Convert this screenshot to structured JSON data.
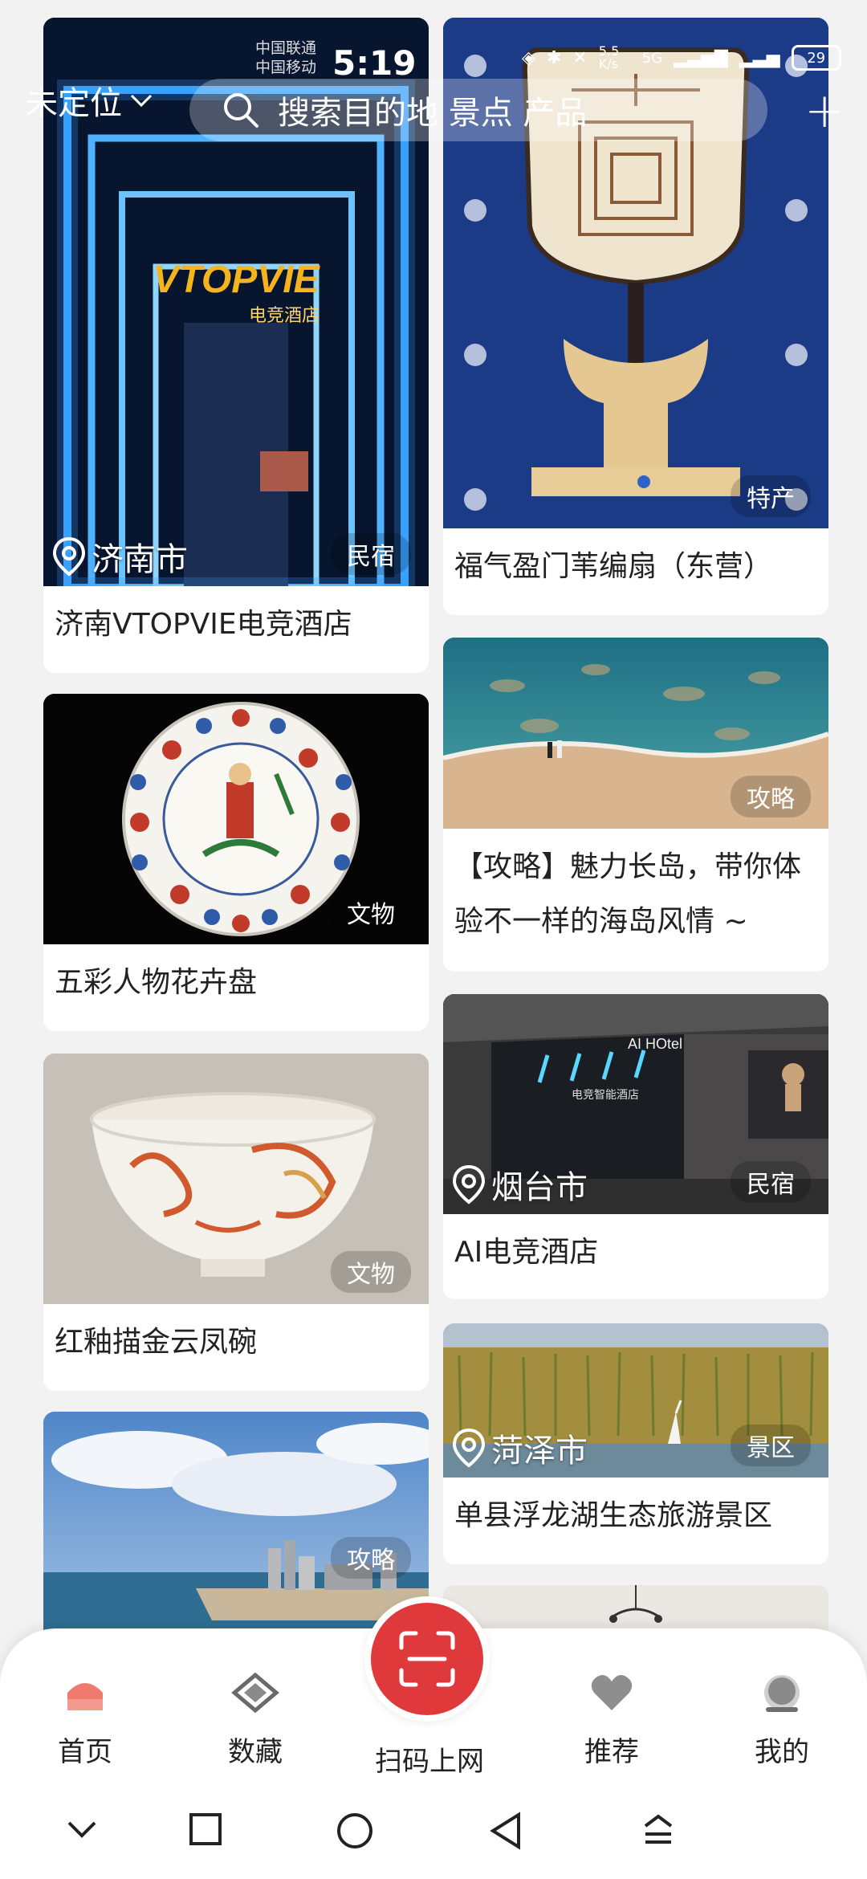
{
  "status_bar": {
    "carrier_1": "中国联通",
    "carrier_2": "中国移动",
    "time": "5:19",
    "net_speed": "5.5 K/s",
    "network": "5G",
    "battery": "29"
  },
  "header": {
    "location": "未定位",
    "search_placeholder": "搜索目的地 景点 产品"
  },
  "feed": {
    "left": [
      {
        "title": "济南VTOPVIE电竞酒店",
        "tag": "民宿",
        "city": "济南市",
        "sign_text": "VTOPVIE",
        "sign_sub": "电竞酒店"
      },
      {
        "title": "五彩人物花卉盘",
        "tag": "文物"
      },
      {
        "title": "红釉描金云凤碗",
        "tag": "文物"
      },
      {
        "title": "",
        "tag": "攻略"
      }
    ],
    "right": [
      {
        "title": "福气盈门苇编扇（东营）",
        "tag": "特产"
      },
      {
        "title": "【攻略】魅力长岛，带你体验不一样的海岛风情 ~",
        "tag": "攻略"
      },
      {
        "title": "AI电竞酒店",
        "tag": "民宿",
        "city": "烟台市",
        "sign_text": "AI HOtel",
        "sign_sub": "电竞智能酒店"
      },
      {
        "title": "单县浮龙湖生态旅游景区",
        "tag": "景区",
        "city": "菏泽市"
      }
    ]
  },
  "bottom_nav": {
    "home": "首页",
    "collections": "数藏",
    "scan": "扫码上网",
    "recommend": "推荐",
    "mine": "我的"
  },
  "colors": {
    "accent": "#e0393b",
    "home_icon": "#f07a6e"
  }
}
